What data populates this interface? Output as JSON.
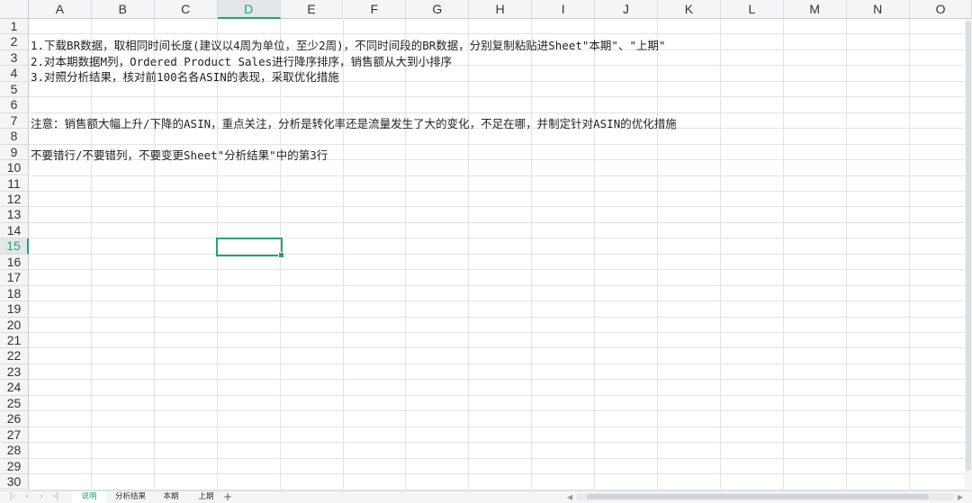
{
  "columns": [
    "A",
    "B",
    "C",
    "D",
    "E",
    "F",
    "G",
    "H",
    "I",
    "J",
    "K",
    "L",
    "M",
    "N",
    "O"
  ],
  "selected_column": "D",
  "rows": [
    "1",
    "2",
    "3",
    "4",
    "5",
    "6",
    "7",
    "8",
    "9",
    "10",
    "11",
    "12",
    "13",
    "14",
    "15",
    "16",
    "17",
    "18",
    "19",
    "20",
    "21",
    "22",
    "23",
    "24",
    "25",
    "26",
    "27",
    "28",
    "29",
    "30"
  ],
  "selected_row": "15",
  "cells": {
    "A2": "1.下载BR数据，取相同时间长度(建议以4周为单位，至少2周)，不同时间段的BR数据，分别复制粘贴进Sheet\"本期\"、\"上期\"",
    "A3": "2.对本期数据M列，Ordered Product Sales进行降序排序，销售额从大到小排序",
    "A4": "3.对照分析结果，核对前100名各ASIN的表现，采取优化措施",
    "A7": "注意：销售额大幅上升/下降的ASIN，重点关注，分析是转化率还是流量发生了大的变化，不足在哪，并制定针对ASIN的优化措施",
    "A9": "不要错行/不要错列，不要变更Sheet\"分析结果\"中的第3行"
  },
  "sheet_tabs": [
    {
      "label": "说明",
      "active": true
    },
    {
      "label": "分析结果",
      "active": false
    },
    {
      "label": "本期",
      "active": false
    },
    {
      "label": "上期",
      "active": false
    }
  ],
  "add_sheet_label": "+",
  "icons": {
    "first": "first-sheet-icon",
    "prev": "prev-sheet-icon",
    "next": "next-sheet-icon",
    "last": "last-sheet-icon",
    "add": "add-sheet-icon"
  },
  "colors": {
    "accent": "#2b9f73",
    "header_bg": "#f4f5f6",
    "grid_line": "#e1e3e5"
  }
}
